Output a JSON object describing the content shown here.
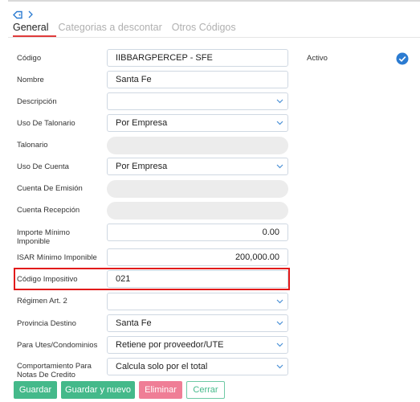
{
  "tabs": [
    {
      "label": "General"
    },
    {
      "label": "Categorias a descontar"
    },
    {
      "label": "Otros Códigos"
    }
  ],
  "activo": {
    "label": "Activo",
    "checked": true
  },
  "fields": {
    "codigo": {
      "label": "Código",
      "value": "IIBBARGPERCEP - SFE"
    },
    "nombre": {
      "label": "Nombre",
      "value": "Santa Fe"
    },
    "descripcion": {
      "label": "Descripción",
      "value": ""
    },
    "uso_talonario": {
      "label": "Uso De Talonario",
      "value": "Por Empresa"
    },
    "talonario": {
      "label": "Talonario",
      "value": ""
    },
    "uso_cuenta": {
      "label": "Uso De Cuenta",
      "value": "Por Empresa"
    },
    "cuenta_emision": {
      "label": "Cuenta De Emisión",
      "value": ""
    },
    "cuenta_recepcion": {
      "label": "Cuenta Recepción",
      "value": ""
    },
    "importe_minimo": {
      "label_line1": "Importe Mínimo",
      "label_line2": "Imponible",
      "value": "0.00"
    },
    "isar_minimo": {
      "label": "ISAR Mínimo Imponible",
      "value": "200,000.00"
    },
    "codigo_impositivo": {
      "label": "Código Impositivo",
      "value": "021"
    },
    "regimen": {
      "label": "Régimen Art. 2",
      "value": ""
    },
    "provincia_destino": {
      "label": "Provincia Destino",
      "value": "Santa Fe"
    },
    "utes": {
      "label": "Para Utes/Condominios",
      "value": "Retiene por proveedor/UTE"
    },
    "comportamiento": {
      "label_line1": "Comportamiento Para",
      "label_line2": "Notas De Credito",
      "value": "Calcula solo por el total"
    }
  },
  "buttons": {
    "guardar": "Guardar",
    "guardar_nuevo": "Guardar y nuevo",
    "eliminar": "Eliminar",
    "cerrar": "Cerrar"
  },
  "colors": {
    "accent_blue": "#2b7bd1",
    "tab_underline": "#e03b3b",
    "highlight_red": "#e21a1a",
    "button_green": "#44b98a",
    "button_pink": "#ef7e96"
  }
}
